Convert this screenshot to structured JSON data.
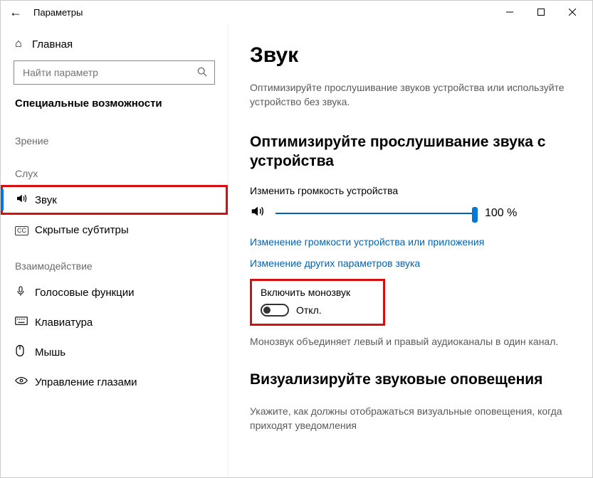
{
  "window": {
    "title": "Параметры"
  },
  "sidebar": {
    "home": "Главная",
    "search_placeholder": "Найти параметр",
    "section": "Специальные возможности",
    "groups": {
      "vision": "Зрение",
      "hearing": "Слух",
      "interaction": "Взаимодействие"
    },
    "items": {
      "sound": "Звук",
      "captions": "Скрытые субтитры",
      "speech": "Голосовые функции",
      "keyboard": "Клавиатура",
      "mouse": "Мышь",
      "eye": "Управление глазами"
    }
  },
  "main": {
    "h1": "Звук",
    "desc": "Оптимизируйте прослушивание звуков устройства или используйте устройство без звука.",
    "optimize_h2": "Оптимизируйте прослушивание звука с устройства",
    "volume_label": "Изменить громкость устройства",
    "volume_value": "100 %",
    "link1": "Изменение громкости устройства или приложения",
    "link2": "Изменение других параметров звука",
    "mono_title": "Включить монозвук",
    "mono_state": "Откл.",
    "mono_desc": "Монозвук объединяет левый и правый аудиоканалы в один канал.",
    "visualize_h2": "Визуализируйте звуковые оповещения",
    "visualize_desc": "Укажите, как должны отображаться визуальные оповещения, когда приходят уведомления"
  }
}
